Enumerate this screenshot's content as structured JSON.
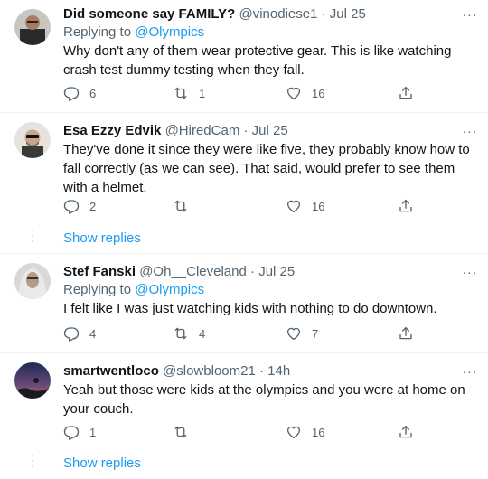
{
  "tweets": [
    {
      "name": "Did someone say FAMILY?",
      "handle": "@vinodiese1",
      "dot": "·",
      "time": "Jul 25",
      "replying_prefix": "Replying to ",
      "replying_to": "@Olympics",
      "text": "Why don't any of them wear protective gear. This is like watching crash test dummy testing when they fall.",
      "replies": "6",
      "retweets": "1",
      "likes": "16",
      "more": "···"
    },
    {
      "name": "Esa Ezzy Edvik",
      "handle": "@HiredCam",
      "dot": "·",
      "time": "Jul 25",
      "text": "They've done it since they were like five, they probably know how to fall correctly (as we can see). That said, would prefer to see them with a helmet.",
      "replies": "2",
      "retweets": "",
      "likes": "16",
      "more": "···"
    },
    {
      "name": "Stef Fanski",
      "handle": "@Oh__Cleveland",
      "dot": "·",
      "time": "Jul 25",
      "replying_prefix": "Replying to ",
      "replying_to": "@Olympics",
      "text": "I felt like I was just watching kids with nothing to do downtown.",
      "replies": "4",
      "retweets": "4",
      "likes": "7",
      "more": "···"
    },
    {
      "name": "smartwentloco",
      "handle": "@slowbloom21",
      "dot": "·",
      "time": "14h",
      "text": "Yeah but those were kids at the olympics and you were at home on your couch.",
      "replies": "1",
      "retweets": "",
      "likes": "16",
      "more": "···"
    }
  ],
  "show_replies": "Show replies",
  "icons": {
    "reply": "reply-icon",
    "retweet": "retweet-icon",
    "like": "heart-icon",
    "share": "share-icon",
    "more": "more-icon"
  },
  "colors": {
    "link": "#1d9bf0",
    "secondary_text": "#536471",
    "primary_text": "#0f1419",
    "divider": "#eff3f4"
  }
}
